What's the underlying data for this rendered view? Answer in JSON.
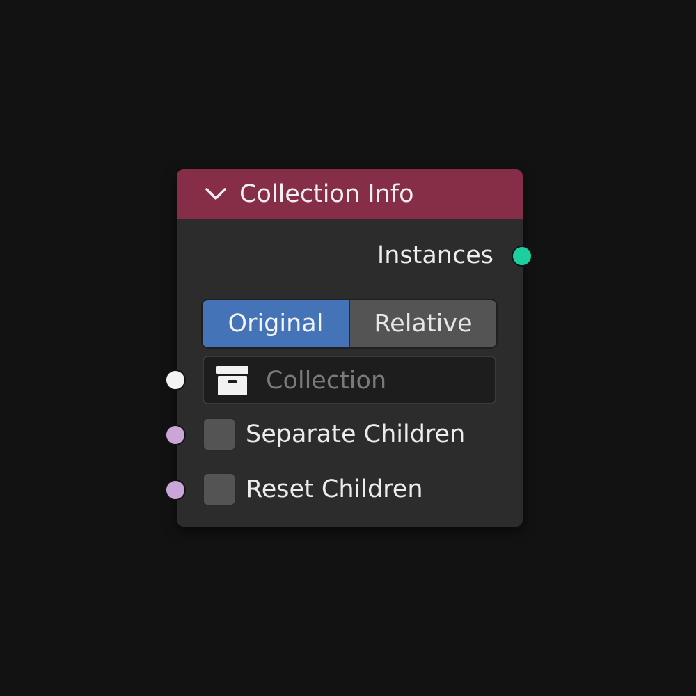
{
  "node": {
    "title": "Collection Info",
    "header_color": "#862d48",
    "collapse_icon": "chevron-down-icon"
  },
  "outputs": {
    "instances_label": "Instances",
    "instances_socket_color": "#1bcfa0"
  },
  "transform_space": {
    "options": [
      "Original",
      "Relative"
    ],
    "selected": "Original",
    "active_color": "#4573b8"
  },
  "inputs": {
    "collection": {
      "placeholder": "Collection",
      "icon": "collection-box-icon",
      "socket_color": "#f2f2f2"
    },
    "separate_children": {
      "label": "Separate Children",
      "checked": false,
      "socket_color": "#c9a5d8"
    },
    "reset_children": {
      "label": "Reset Children",
      "checked": false,
      "socket_color": "#c9a5d8"
    }
  }
}
